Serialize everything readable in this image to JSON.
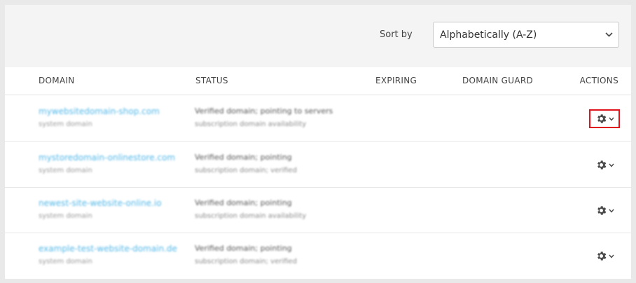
{
  "toolbar": {
    "sort_label": "Sort by",
    "sort_value": "Alphabetically (A-Z)"
  },
  "table": {
    "headers": {
      "domain": "DOMAIN",
      "status": "STATUS",
      "expiring": "EXPIRING",
      "guard": "DOMAIN GUARD",
      "actions": "ACTIONS"
    },
    "rows": [
      {
        "domain": "mywebsitedomain-shop.com",
        "domain_sub": "system domain",
        "status": "Verified domain; pointing to servers",
        "status_sub": "subscription domain availability",
        "highlighted": true
      },
      {
        "domain": "mystoredomain-onlinestore.com",
        "domain_sub": "system domain",
        "status": "Verified domain; pointing",
        "status_sub": "subscription domain; verified",
        "highlighted": false
      },
      {
        "domain": "newest-site-website-online.io",
        "domain_sub": "system domain",
        "status": "Verified domain; pointing",
        "status_sub": "subscription domain availability",
        "highlighted": false
      },
      {
        "domain": "example-test-website-domain.de",
        "domain_sub": "system domain",
        "status": "Verified domain; pointing",
        "status_sub": "subscription domain; verified",
        "highlighted": false
      }
    ]
  },
  "icons": {
    "actions": "gear-icon",
    "dropdown": "chevron-down-icon"
  },
  "colors": {
    "link": "#52b8e8",
    "highlight": "#e0141d"
  }
}
